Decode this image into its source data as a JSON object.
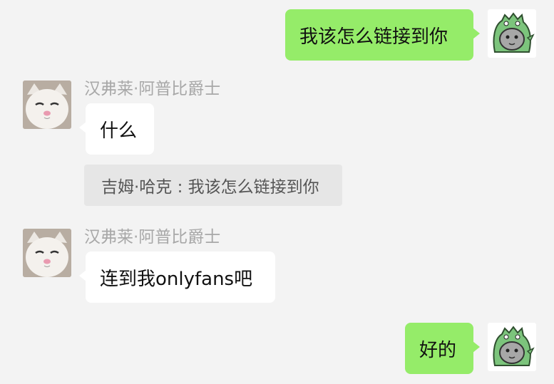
{
  "messages": [
    {
      "from": "me",
      "text": "我该怎么链接到你"
    },
    {
      "from": "other",
      "sender": "汉弗莱·阿普比爵士",
      "text": "什么"
    },
    {
      "quote": "吉姆·哈克 : 我该怎么链接到你"
    },
    {
      "from": "other",
      "sender": "汉弗莱·阿普比爵士",
      "text": "连到我onlyfans吧"
    },
    {
      "from": "me",
      "text": "好的"
    }
  ],
  "colors": {
    "background": "#f3f3f3",
    "my_bubble": "#95ec69",
    "their_bubble": "#ffffff"
  },
  "avatars": {
    "me": "cat-in-dinosaur-costume-avatar",
    "other": "white-cat-avatar"
  }
}
